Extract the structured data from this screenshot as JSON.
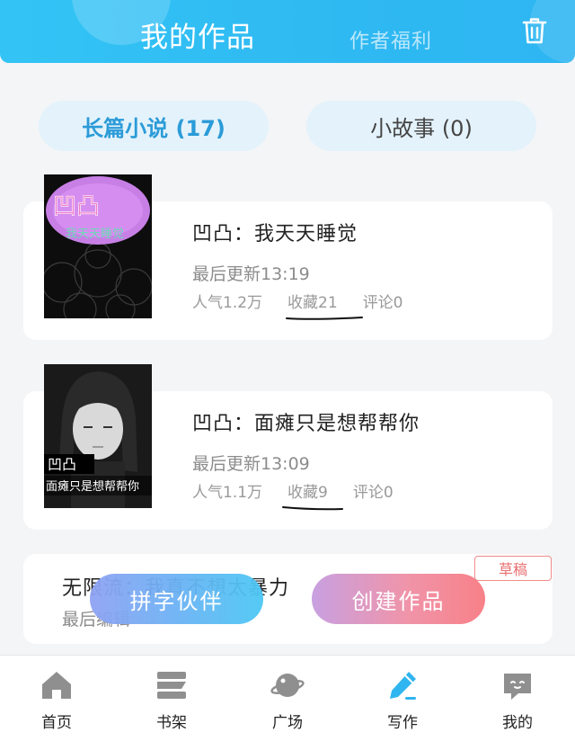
{
  "header": {
    "tabs": [
      "我的作品",
      "作者福利"
    ],
    "trash_icon": "trash-icon"
  },
  "segments": {
    "novel": "长篇小说 (17)",
    "story": "小故事 (0)"
  },
  "works": [
    {
      "title": "凹凸：我天天睡觉",
      "updated": "最后更新13:19",
      "popularity": "人气1.2万",
      "favorites": "收藏21",
      "comments": "评论0",
      "cover": {
        "text": "凹凸",
        "sub": "我天天睡觉"
      }
    },
    {
      "title": "凹凸：面瘫只是想帮帮你",
      "updated": "最后更新13:09",
      "popularity": "人气1.1万",
      "favorites": "收藏9",
      "comments": "评论0",
      "cover": {
        "text": "凹凸",
        "sub": "面瘫只是想帮帮你"
      }
    },
    {
      "title": "无限流：我真不想太暴力",
      "updated": "最后编辑",
      "badge": "草稿"
    }
  ],
  "actions": {
    "partner": "拼字伙伴",
    "create": "创建作品"
  },
  "nav": [
    {
      "label": "首页",
      "icon": "home-icon"
    },
    {
      "label": "书架",
      "icon": "bookshelf-icon"
    },
    {
      "label": "广场",
      "icon": "planet-icon"
    },
    {
      "label": "写作",
      "icon": "pen-icon",
      "active": true
    },
    {
      "label": "我的",
      "icon": "chat-bubble-icon"
    }
  ],
  "colors": {
    "header": "#2fb9f2",
    "accent_blue": "#2b9bd8",
    "nav_active": "#2fb5f0",
    "draft": "#ea6f6f"
  }
}
